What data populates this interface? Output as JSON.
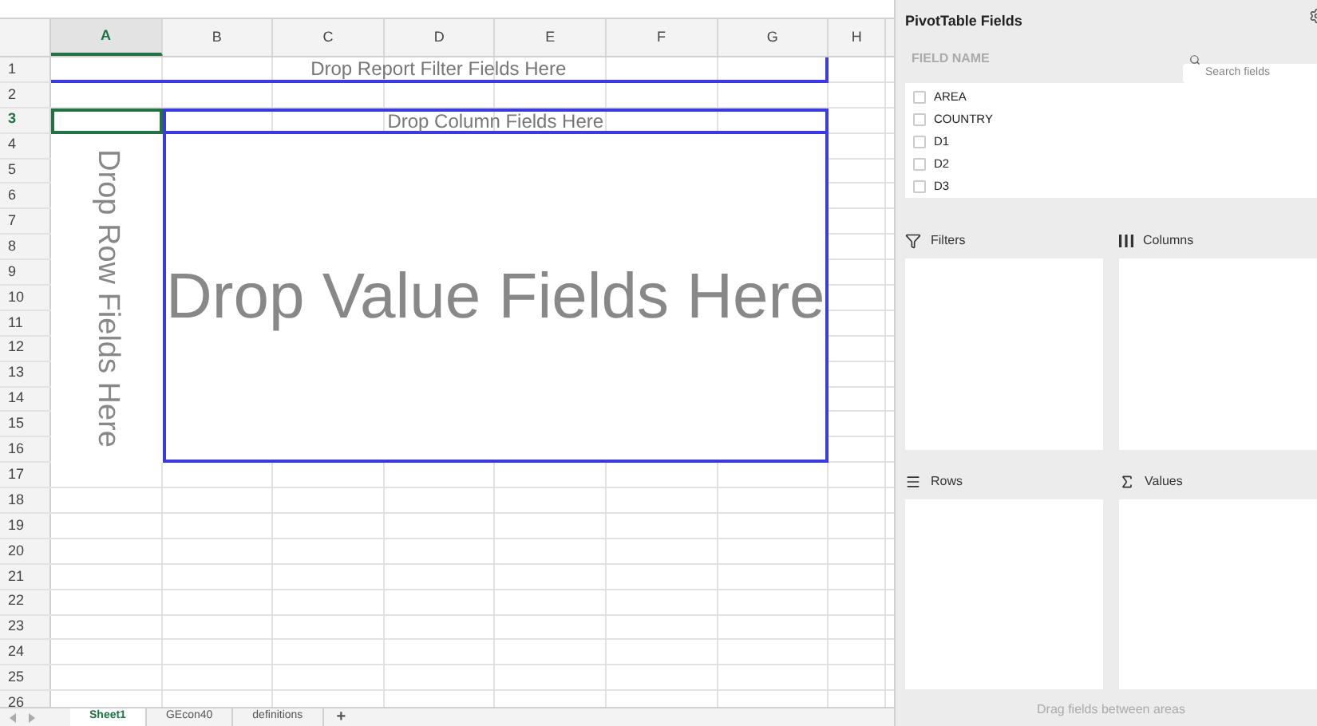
{
  "columns": [
    {
      "label": "A",
      "selected": true
    },
    {
      "label": "B",
      "selected": false
    },
    {
      "label": "C",
      "selected": false
    },
    {
      "label": "D",
      "selected": false
    },
    {
      "label": "E",
      "selected": false
    },
    {
      "label": "F",
      "selected": false
    },
    {
      "label": "G",
      "selected": false
    },
    {
      "label": "H",
      "selected": false
    }
  ],
  "rows": [
    {
      "label": "1",
      "selected": false
    },
    {
      "label": "2",
      "selected": false
    },
    {
      "label": "3",
      "selected": true
    },
    {
      "label": "4",
      "selected": false
    },
    {
      "label": "5",
      "selected": false
    },
    {
      "label": "6",
      "selected": false
    },
    {
      "label": "7",
      "selected": false
    },
    {
      "label": "8",
      "selected": false
    },
    {
      "label": "9",
      "selected": false
    },
    {
      "label": "10",
      "selected": false
    },
    {
      "label": "11",
      "selected": false
    },
    {
      "label": "12",
      "selected": false
    },
    {
      "label": "13",
      "selected": false
    },
    {
      "label": "14",
      "selected": false
    },
    {
      "label": "15",
      "selected": false
    },
    {
      "label": "16",
      "selected": false
    },
    {
      "label": "17",
      "selected": false
    },
    {
      "label": "18",
      "selected": false
    },
    {
      "label": "19",
      "selected": false
    },
    {
      "label": "20",
      "selected": false
    },
    {
      "label": "21",
      "selected": false
    },
    {
      "label": "22",
      "selected": false
    },
    {
      "label": "23",
      "selected": false
    },
    {
      "label": "24",
      "selected": false
    },
    {
      "label": "25",
      "selected": false
    },
    {
      "label": "26",
      "selected": false
    }
  ],
  "pivot_zones": {
    "report_filter": "Drop Report Filter Fields Here",
    "column": "Drop Column Fields Here",
    "row": "Drop Row Fields Here",
    "value": "Drop Value Fields Here"
  },
  "sheet_tabs": [
    {
      "label": "Sheet1",
      "selected": true
    },
    {
      "label": "GEcon40",
      "selected": false
    },
    {
      "label": "definitions",
      "selected": false
    }
  ],
  "add_sheet": "+",
  "panel": {
    "title": "PivotTable Fields",
    "field_name_heading": "FIELD NAME",
    "search": {
      "placeholder": "Search fields"
    },
    "fields": [
      {
        "label": "AREA",
        "checked": false
      },
      {
        "label": "COUNTRY",
        "checked": false
      },
      {
        "label": "D1",
        "checked": false
      },
      {
        "label": "D2",
        "checked": false
      },
      {
        "label": "D3",
        "checked": false
      }
    ],
    "areas": [
      {
        "kind": "filters",
        "label": "Filters"
      },
      {
        "kind": "columns",
        "label": "Columns"
      },
      {
        "kind": "rows",
        "label": "Rows"
      },
      {
        "kind": "values",
        "label": "Values"
      }
    ],
    "footer": "Drag fields between areas"
  }
}
